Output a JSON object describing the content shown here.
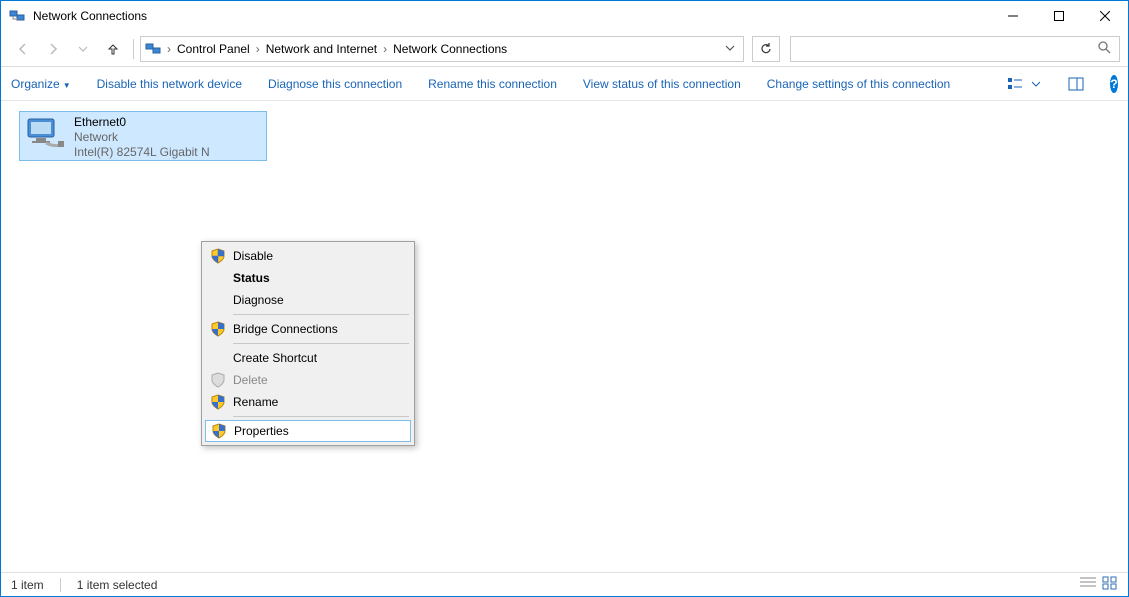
{
  "window": {
    "title": "Network Connections"
  },
  "breadcrumbs": {
    "root": "Control Panel",
    "mid": "Network and Internet",
    "leaf": "Network Connections"
  },
  "commands": {
    "organize": "Organize",
    "disable": "Disable this network device",
    "diagnose": "Diagnose this connection",
    "rename": "Rename this connection",
    "viewstatus": "View status of this connection",
    "changesettings": "Change settings of this connection"
  },
  "connection": {
    "name": "Ethernet0",
    "status": "Network",
    "device": "Intel(R) 82574L Gigabit N"
  },
  "context_menu": {
    "disable": "Disable",
    "status": "Status",
    "diagnose": "Diagnose",
    "bridge": "Bridge Connections",
    "shortcut": "Create Shortcut",
    "delete": "Delete",
    "rename": "Rename",
    "properties": "Properties"
  },
  "statusbar": {
    "count": "1 item",
    "selected": "1 item selected"
  }
}
